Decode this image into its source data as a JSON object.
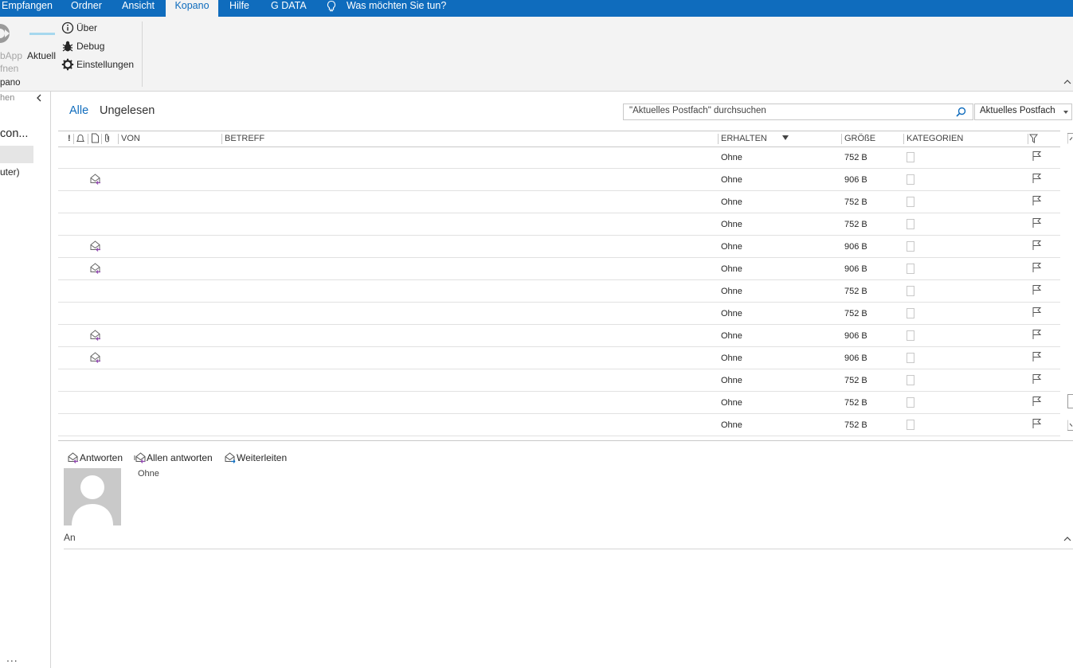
{
  "tabs": [
    "Empfangen",
    "Ordner",
    "Ansicht",
    "Kopano",
    "Hilfe",
    "G DATA"
  ],
  "tell_me": "Was möchten Sie tun?",
  "ribbon": {
    "webapp_label_1": "bApp",
    "webapp_label_2": "fnen",
    "aktuell": "Aktuell",
    "ueber": "Über",
    "debug": "Debug",
    "einstellungen": "Einstellungen",
    "group_label": "pano"
  },
  "nav": {
    "top_fragment": "hen",
    "account_fragment": "con...",
    "item_fragment": "uter)",
    "more": "..."
  },
  "filters": {
    "all": "Alle",
    "unread": "Ungelesen"
  },
  "search": {
    "placeholder": "\"Aktuelles Postfach\" durchsuchen",
    "scope": "Aktuelles Postfach"
  },
  "columns": {
    "importance": "!",
    "from": "VON",
    "subject": "BETREFF",
    "received": "ERHALTEN",
    "size": "GRÖßE",
    "categories": "KATEGORIEN"
  },
  "messages": [
    {
      "received": "Ohne",
      "size": "752 B",
      "icon": false
    },
    {
      "received": "Ohne",
      "size": "906 B",
      "icon": true
    },
    {
      "received": "Ohne",
      "size": "752 B",
      "icon": false
    },
    {
      "received": "Ohne",
      "size": "752 B",
      "icon": false
    },
    {
      "received": "Ohne",
      "size": "906 B",
      "icon": true
    },
    {
      "received": "Ohne",
      "size": "906 B",
      "icon": true
    },
    {
      "received": "Ohne",
      "size": "752 B",
      "icon": false
    },
    {
      "received": "Ohne",
      "size": "752 B",
      "icon": false
    },
    {
      "received": "Ohne",
      "size": "906 B",
      "icon": true
    },
    {
      "received": "Ohne",
      "size": "906 B",
      "icon": true
    },
    {
      "received": "Ohne",
      "size": "752 B",
      "icon": false
    },
    {
      "received": "Ohne",
      "size": "752 B",
      "icon": false
    },
    {
      "received": "Ohne",
      "size": "752 B",
      "icon": false
    }
  ],
  "reading": {
    "reply": "Antworten",
    "reply_all": "Allen antworten",
    "forward": "Weiterleiten",
    "sender": "Ohne",
    "to_label": "An"
  },
  "colors": {
    "accent": "#0f6cbd",
    "reply_icon": "#8e44ad"
  }
}
